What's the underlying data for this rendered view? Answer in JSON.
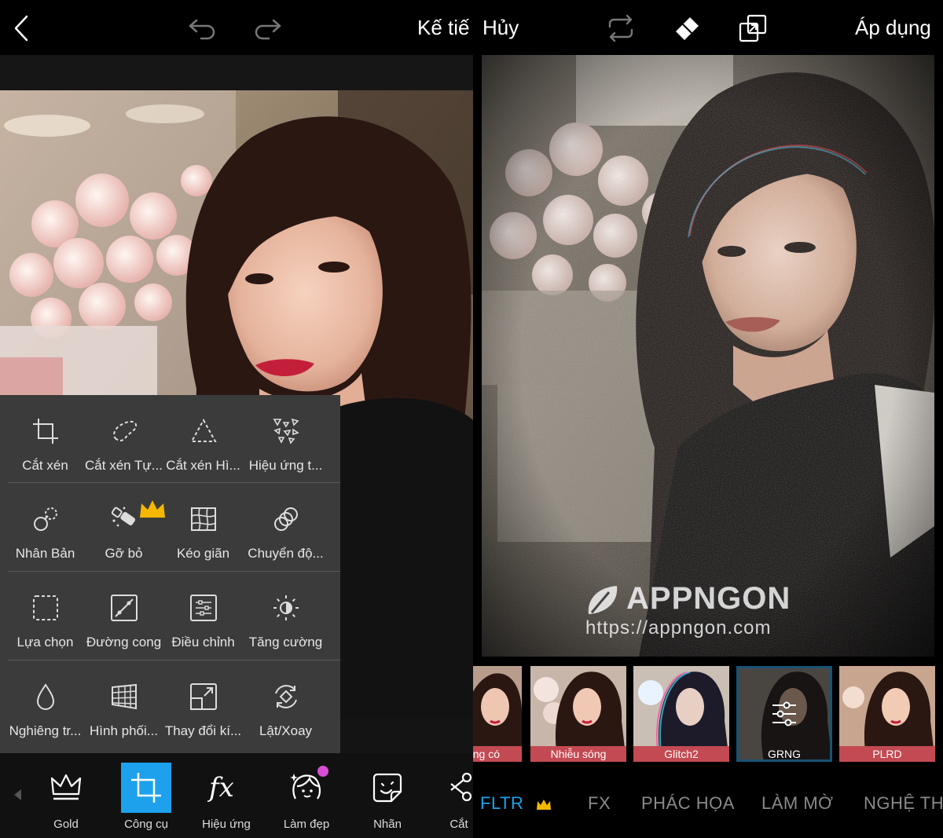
{
  "left": {
    "top_bar": {
      "next_label": "Kế tiế"
    },
    "tools": [
      [
        {
          "label": "Cắt xén",
          "icon": "crop-icon"
        },
        {
          "label": "Cắt xén Tự...",
          "icon": "freecrop-icon"
        },
        {
          "label": "Cắt xén Hì...",
          "icon": "shapecrop-icon"
        },
        {
          "label": "Hiệu ứng t...",
          "icon": "dispersion-icon"
        }
      ],
      [
        {
          "label": "Nhân Bản",
          "icon": "clone-icon"
        },
        {
          "label": "Gỡ bỏ",
          "icon": "remove-icon",
          "premium": true
        },
        {
          "label": "Kéo giãn",
          "icon": "stretch-icon"
        },
        {
          "label": "Chuyển độ...",
          "icon": "motion-icon"
        }
      ],
      [
        {
          "label": "Lựa chọn",
          "icon": "selection-icon"
        },
        {
          "label": "Đường cong",
          "icon": "curves-icon"
        },
        {
          "label": "Điều chỉnh",
          "icon": "adjust-icon"
        },
        {
          "label": "Tăng cường",
          "icon": "enhance-icon"
        }
      ],
      [
        {
          "label": "Nghiêng tr...",
          "icon": "tiltshift-icon"
        },
        {
          "label": "Hình phối...",
          "icon": "perspective-icon"
        },
        {
          "label": "Thay đổi kí...",
          "icon": "resize-icon"
        },
        {
          "label": "Lật/Xoay",
          "icon": "flip-rotate-icon"
        }
      ]
    ],
    "bottom_nav": [
      {
        "label": "Gold",
        "icon": "crown-icon"
      },
      {
        "label": "Công cụ",
        "icon": "crop-icon",
        "active": true
      },
      {
        "label": "Hiệu ứng",
        "icon": "fx-icon"
      },
      {
        "label": "Làm đẹp",
        "icon": "beautify-icon"
      },
      {
        "label": "Nhãn",
        "icon": "sticker-icon"
      },
      {
        "label": "Cắt",
        "icon": "cutout-icon"
      }
    ]
  },
  "right": {
    "top_bar": {
      "cancel_label": "Hủy",
      "apply_label": "Áp dụng"
    },
    "watermark": {
      "brand": "APPNGON",
      "url": "https://appngon.com"
    },
    "filters": [
      {
        "label": "ng có"
      },
      {
        "label": "Nhiễu sóng"
      },
      {
        "label": "Glitch2"
      },
      {
        "label": "GRNG",
        "selected": true
      },
      {
        "label": "PLRD"
      }
    ],
    "categories": [
      {
        "label": "FLTR",
        "active": true
      },
      {
        "label": "FX"
      },
      {
        "label": "PHÁC HỌA"
      },
      {
        "label": "LÀM MỜ"
      },
      {
        "label": "NGHỆ TH"
      }
    ]
  },
  "colors": {
    "accent": "#1da1ec",
    "premium": "#f5b800",
    "panel": "#3b3b3b"
  }
}
